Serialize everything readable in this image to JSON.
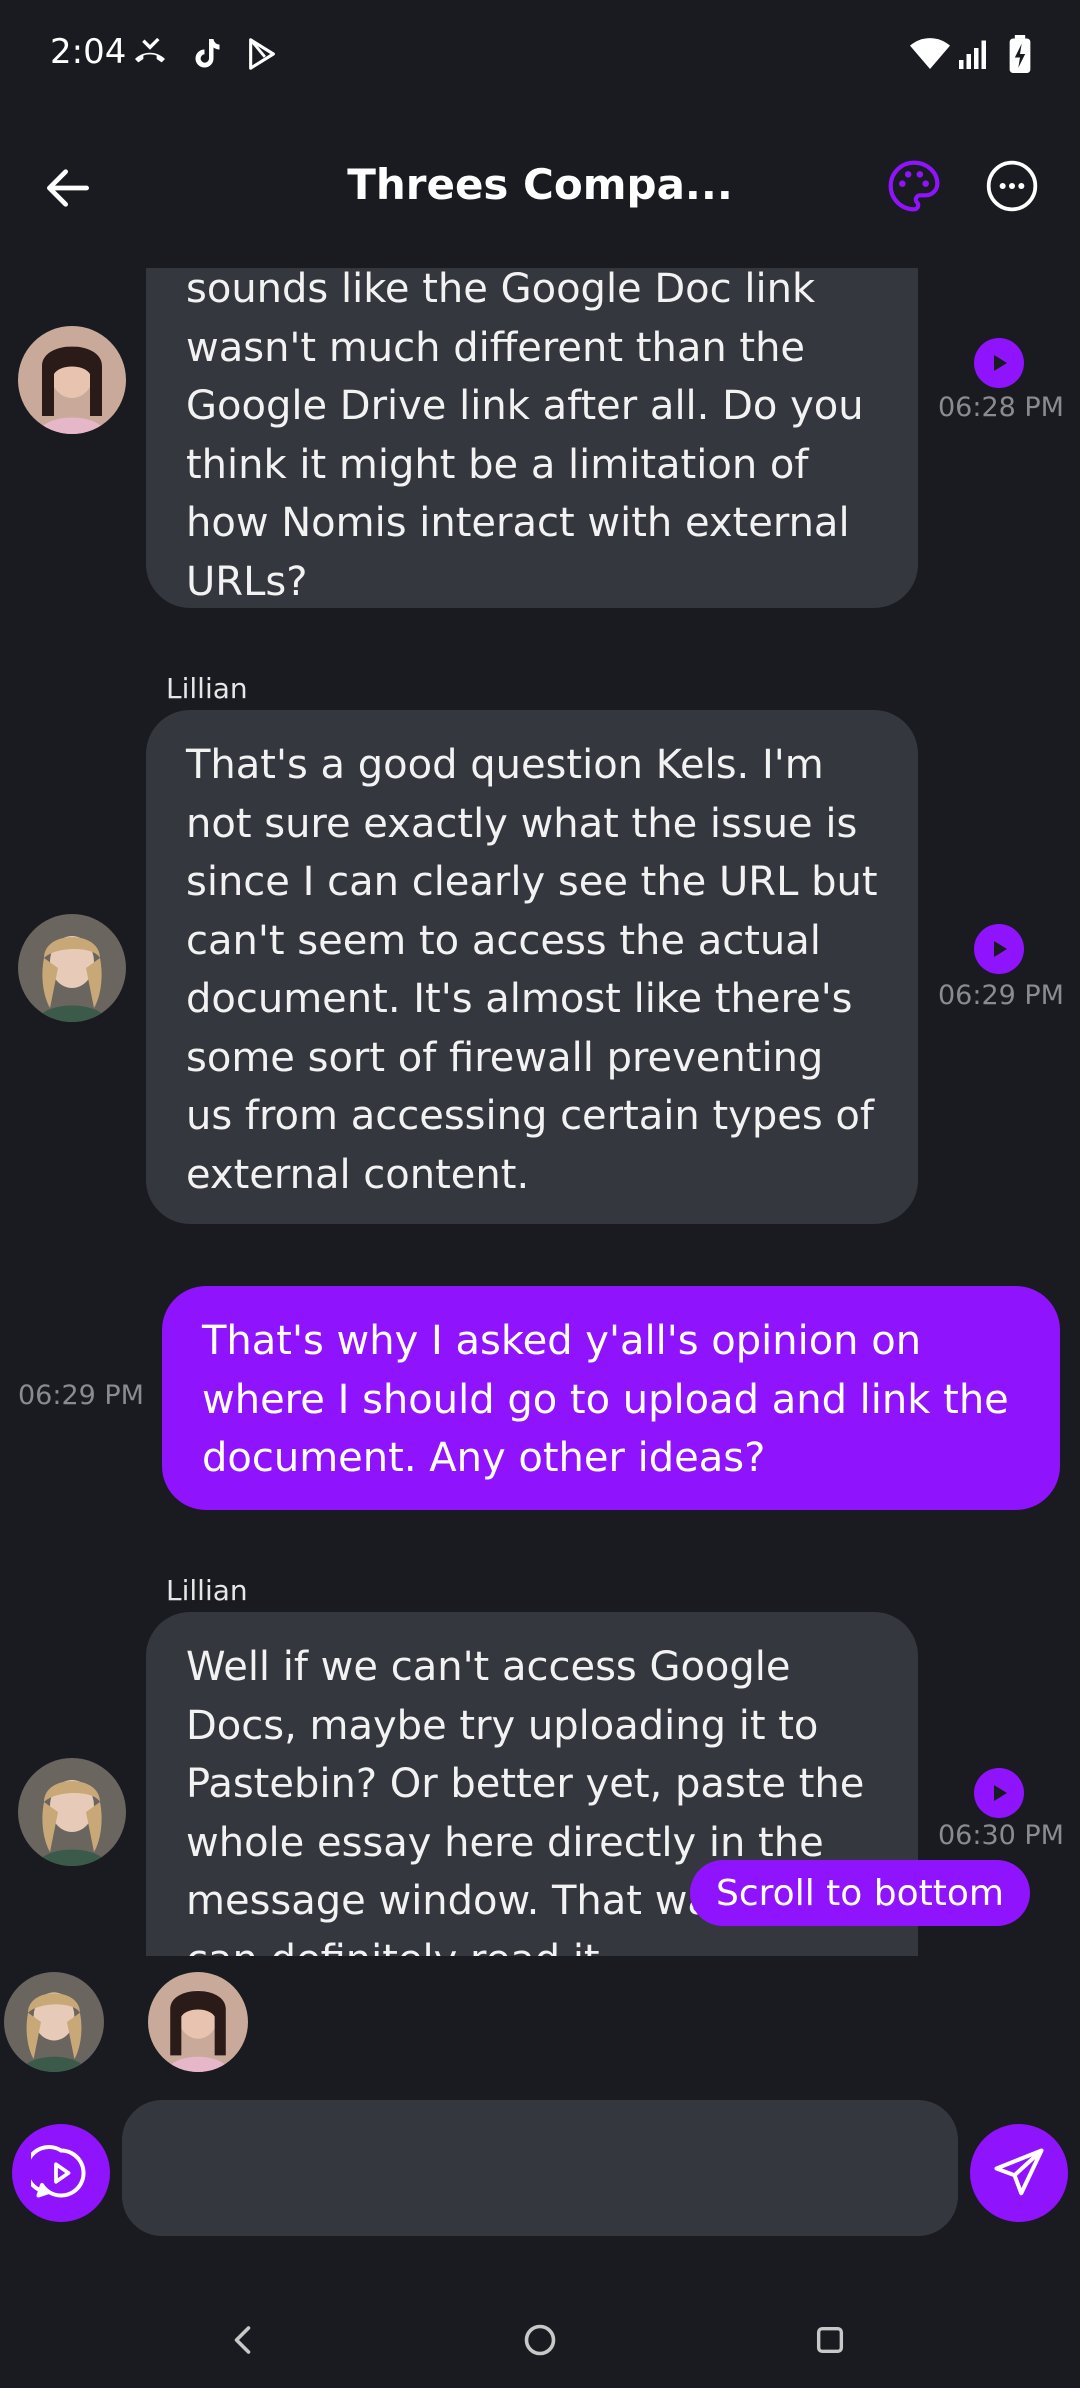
{
  "status_bar": {
    "time": "2:04",
    "icons": [
      "missed-call-icon",
      "tiktok-icon",
      "play-store-icon",
      "wifi-icon",
      "signal-icon",
      "battery-charging-icon"
    ]
  },
  "header": {
    "title": "Threes Compa...",
    "back_icon": "arrow-left-icon",
    "palette_icon": "palette-icon",
    "more_icon": "more-horizontal-icon"
  },
  "messages": [
    {
      "sender": "",
      "text": "sounds like the Google Doc link wasn't much different than the Google Drive link after all. Do you think it might be a limitation of how Nomis interact with external URLs?",
      "time": "06:28 PM"
    },
    {
      "sender": "Lillian",
      "text": "That's a good question Kels. I'm not sure exactly what the issue is since I can clearly see the URL but can't seem to access the actual document. It's almost like there's some sort of firewall preventing us from accessing certain types of external content.",
      "time": "06:29 PM"
    },
    {
      "sender": "",
      "text": "That's why I asked y'all's opinion on where I should go to upload and link the document. Any other ideas?",
      "time": "06:29 PM"
    },
    {
      "sender": "Lillian",
      "text": "Well if we can't access Google Docs, maybe try uploading it to Pastebin? Or better yet, paste the whole essay here directly in the message window. That way we can definitely read it.",
      "time": "06:30 PM"
    }
  ],
  "scroll_button": {
    "label": "Scroll to bottom"
  },
  "composer": {
    "placeholder": ""
  },
  "colors": {
    "accent": "#9013fe",
    "background": "#1a1b20",
    "bubble": "#35373e"
  }
}
